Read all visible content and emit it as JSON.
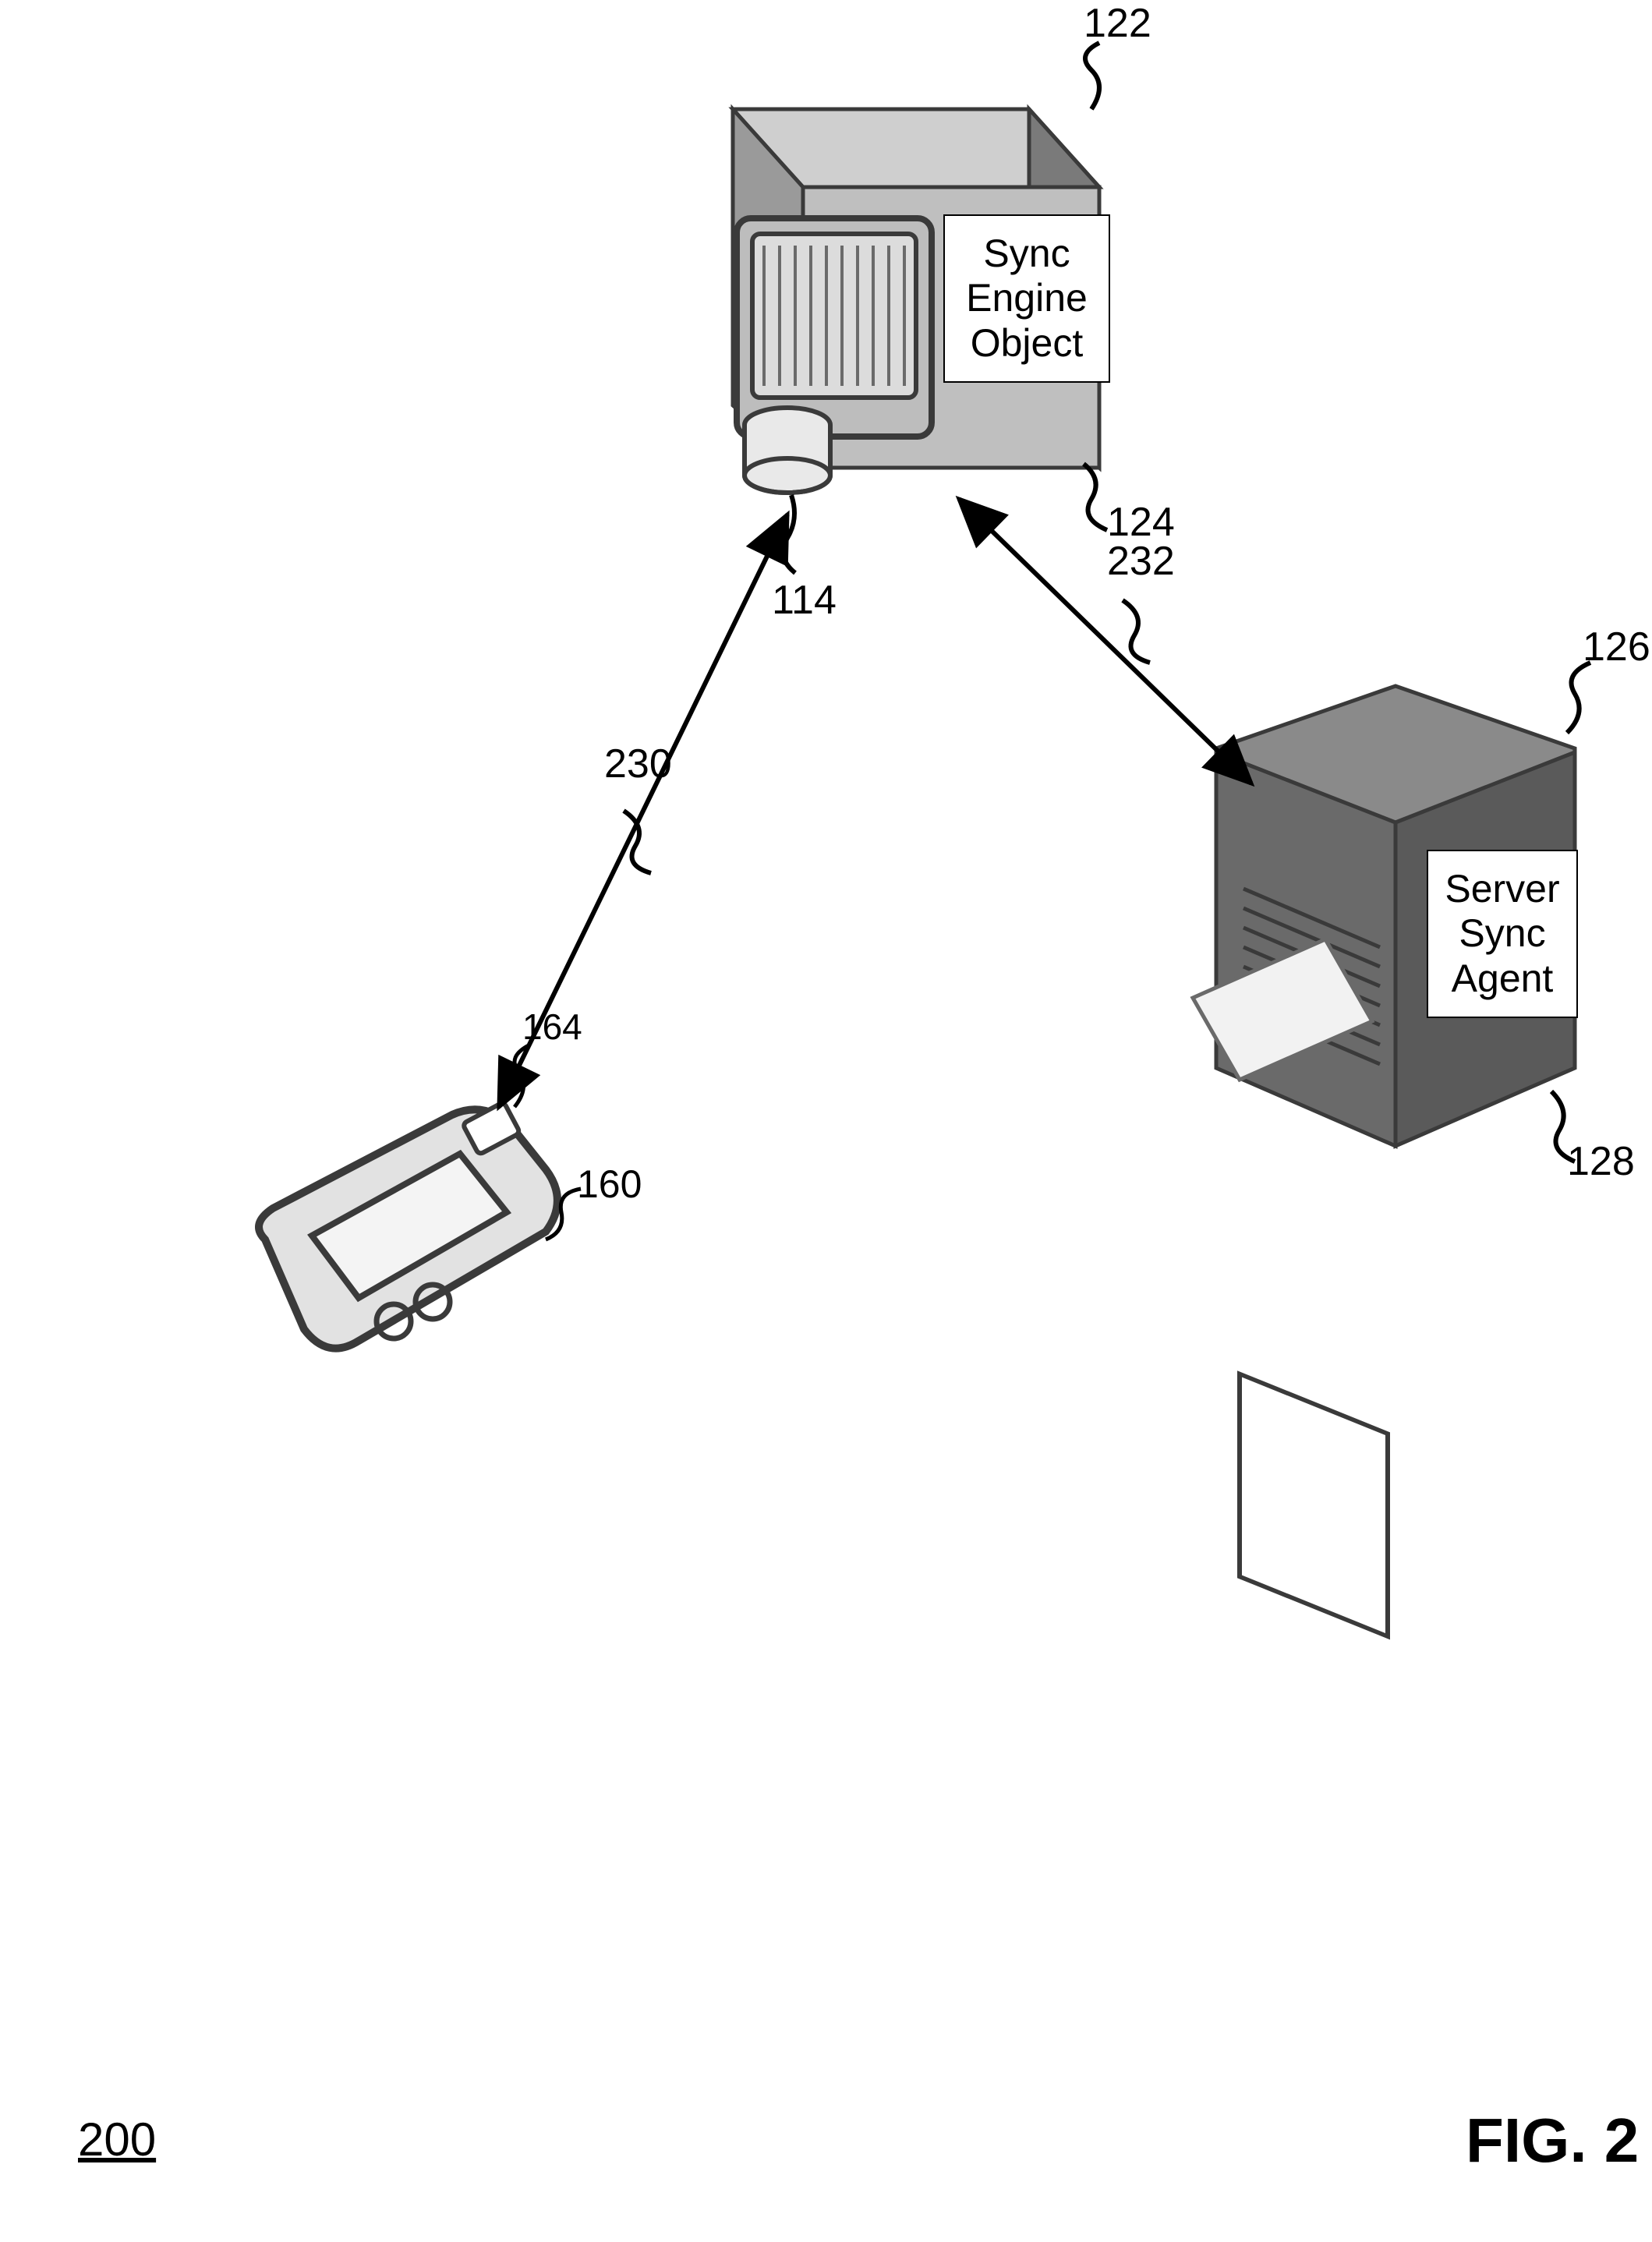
{
  "figure_number_label": "200",
  "figure_caption": "FIG. 2",
  "sync_engine": {
    "ref": "122",
    "box_label_ref": "124",
    "db_ref": "114",
    "box_line1": "Sync",
    "box_line2": "Engine",
    "box_line3": "Object"
  },
  "server": {
    "ref": "126",
    "agent_ref": "128",
    "box_line1": "Server",
    "box_line2": "Sync",
    "box_line3": "Agent"
  },
  "device": {
    "ref": "160",
    "chip_ref": "164"
  },
  "link_left_ref": "230",
  "link_right_ref": "232"
}
